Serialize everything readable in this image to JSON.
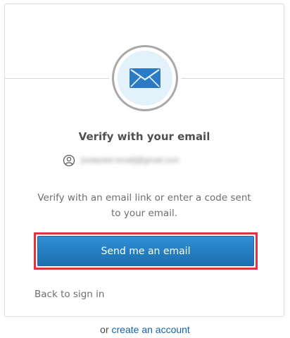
{
  "header": {
    "icon": "envelope-icon",
    "accent_color": "#2a7bc4"
  },
  "main": {
    "title": "Verify with your email",
    "identifier": {
      "icon": "user-icon",
      "value": "[redacted email]@gmail.com"
    },
    "instructions": "Verify with an email link or enter a code sent to your email.",
    "send_button_label": "Send me an email",
    "highlight_color": "#e0313f",
    "back_link": "Back to sign in"
  },
  "footer": {
    "prefix": "or",
    "create_link": "create an account"
  }
}
